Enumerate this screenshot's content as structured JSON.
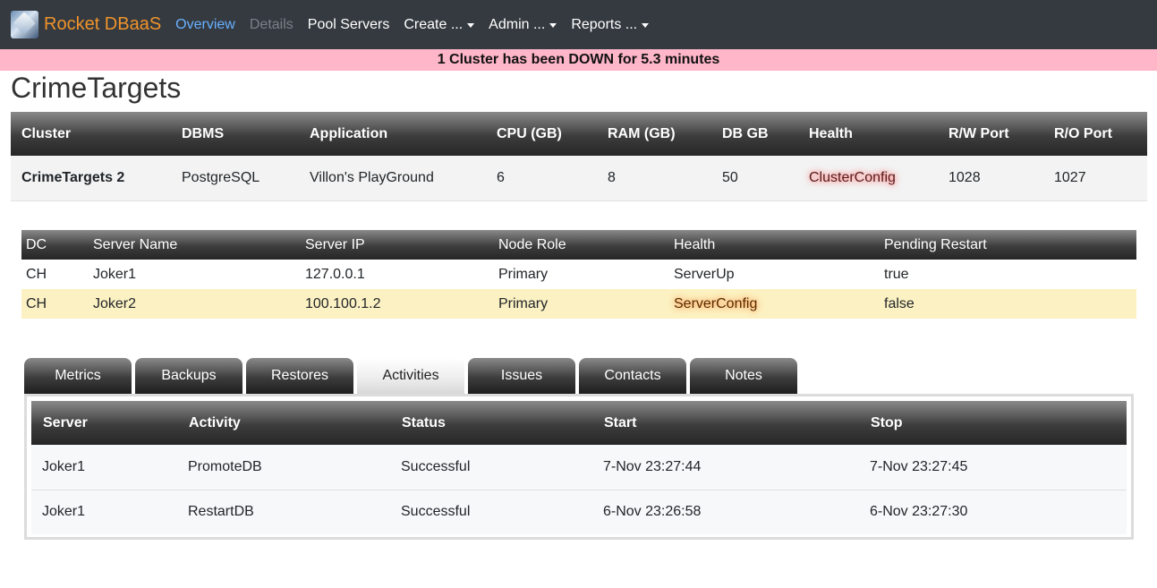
{
  "navbar": {
    "brand": "Rocket DBaaS",
    "links": [
      {
        "label": "Overview"
      },
      {
        "label": "Details"
      },
      {
        "label": "Pool Servers"
      },
      {
        "label": "Create ..."
      },
      {
        "label": "Admin ..."
      },
      {
        "label": "Reports ..."
      }
    ]
  },
  "alert": "1 Cluster has been DOWN for 5.3 minutes",
  "page_title": "CrimeTargets",
  "cluster_table": {
    "headers": [
      "Cluster",
      "DBMS",
      "Application",
      "CPU (GB)",
      "RAM (GB)",
      "DB GB",
      "Health",
      "R/W Port",
      "R/O Port"
    ],
    "row": [
      "CrimeTargets 2",
      "PostgreSQL",
      "Villon's PlayGround",
      "6",
      "8",
      "50",
      "ClusterConfig",
      "1028",
      "1027"
    ]
  },
  "server_table": {
    "headers": [
      "DC",
      "Server Name",
      "Server IP",
      "Node Role",
      "Health",
      "Pending Restart"
    ],
    "rows": [
      [
        "CH",
        "Joker1",
        "127.0.0.1",
        "Primary",
        "ServerUp",
        "true"
      ],
      [
        "CH",
        "Joker2",
        "100.100.1.2",
        "Primary",
        "ServerConfig",
        "false"
      ]
    ]
  },
  "tabs": [
    {
      "label": "Metrics"
    },
    {
      "label": "Backups"
    },
    {
      "label": "Restores"
    },
    {
      "label": "Activities"
    },
    {
      "label": "Issues"
    },
    {
      "label": "Contacts"
    },
    {
      "label": "Notes"
    }
  ],
  "active_tab": "Activities",
  "activity_table": {
    "headers": [
      "Server",
      "Activity",
      "Status",
      "Start",
      "Stop"
    ],
    "rows": [
      [
        "Joker1",
        "PromoteDB",
        "Successful",
        "7-Nov 23:27:44",
        "7-Nov 23:27:45"
      ],
      [
        "Joker1",
        "RestartDB",
        "Successful",
        "6-Nov 23:26:58",
        "6-Nov 23:27:30"
      ]
    ]
  },
  "colors": {
    "navbar_bg": "#343a40",
    "brand": "#f0932b",
    "active_link": "#6ab0ff",
    "alert_bg": "#ffb6c8",
    "warn_row": "#fcf1c2"
  }
}
